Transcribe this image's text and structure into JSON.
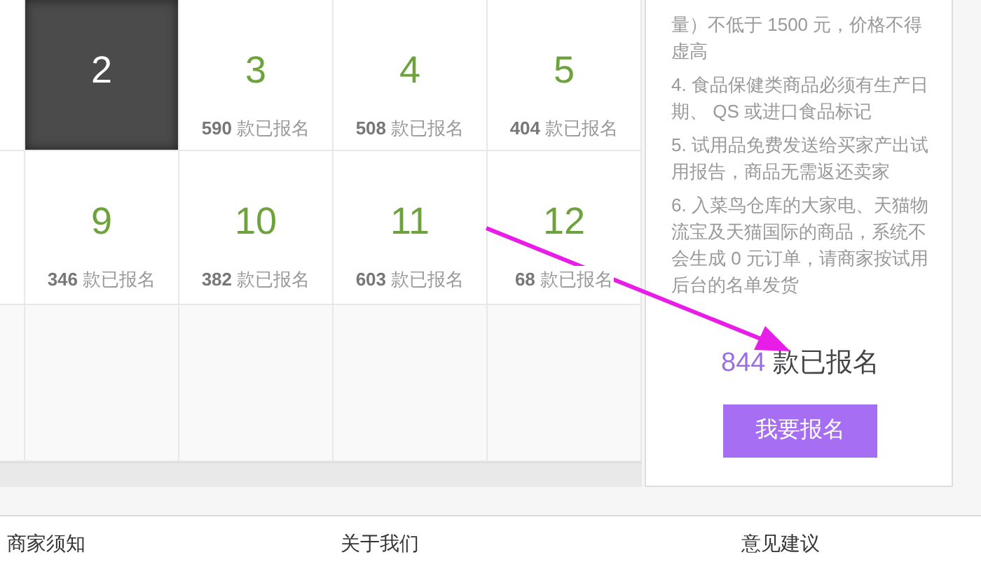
{
  "calendar": {
    "rows": [
      [
        {
          "day": "2",
          "selected": true
        },
        {
          "day": "3",
          "count": "**590** 款已报名",
          "selected": false
        },
        {
          "day": "4",
          "count": "**508** 款已报名",
          "selected": false
        },
        {
          "day": "5",
          "count": "**404** 款已报名",
          "selected": false
        }
      ],
      [
        {
          "day": "9",
          "count": "**346** 款已报名",
          "selected": false
        },
        {
          "day": "10",
          "count": "**382** 款已报名",
          "selected": false
        },
        {
          "day": "11",
          "count": "**603** 款已报名",
          "selected": false
        },
        {
          "day": "12",
          "count": "**68** 款已报名",
          "selected": false
        }
      ]
    ]
  },
  "panel": {
    "rules": [
      "量）不低于 1500 元，价格不得虚高",
      "4. 食品保健类商品必须有生产日期、 QS 或进口食品标记",
      "5. 试用品免费发送给买家产出试用报告，商品无需返还卖家",
      "6. 入菜鸟仓库的大家电、天猫物流宝及天猫国际的商品，系统不会生成 0 元订单，请商家按试用后台的名单发货"
    ],
    "total_count": "844",
    "total_label": "款已报名",
    "button": "我要报名"
  },
  "footer": [
    "商家须知",
    "关于我们",
    "意见建议"
  ]
}
